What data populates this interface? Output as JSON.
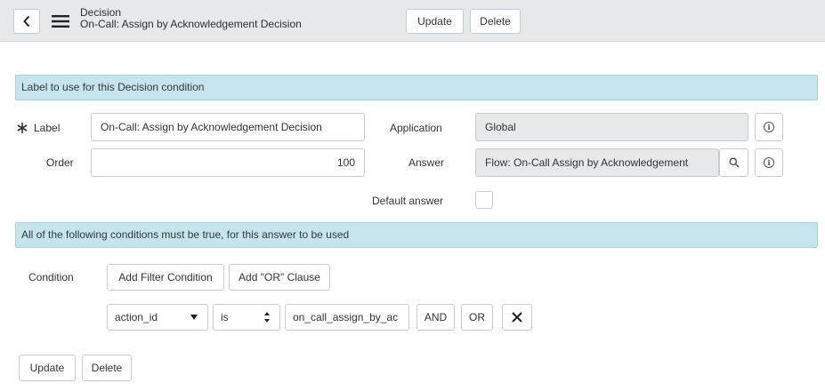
{
  "header": {
    "title_type": "Decision",
    "title_record": "On-Call: Assign by Acknowledgement Decision",
    "update_label": "Update",
    "delete_label": "Delete"
  },
  "sections": {
    "label_section": "Label to use for this Decision condition",
    "conditions_section": "All of the following conditions must be true, for this answer to be used"
  },
  "form": {
    "label_label": "Label",
    "label_value": "On-Call: Assign by Acknowledgement Decision",
    "order_label": "Order",
    "order_value": "100",
    "application_label": "Application",
    "application_value": "Global",
    "answer_label": "Answer",
    "answer_value": "Flow: On-Call Assign by Acknowledgement",
    "default_answer_label": "Default answer",
    "default_answer_checked": false
  },
  "condition": {
    "condition_label": "Condition",
    "add_filter_label": "Add Filter Condition",
    "add_or_label": "Add \"OR\" Clause",
    "field_value": "action_id",
    "operator_value": "is",
    "value_value": "on_call_assign_by_ac",
    "and_label": "AND",
    "or_label": "OR"
  },
  "footer": {
    "update_label": "Update",
    "delete_label": "Delete"
  },
  "icons": {
    "back": "chevron-left-icon",
    "menu": "hamburger-menu-icon",
    "info": "info-icon",
    "search": "search-icon",
    "remove": "close-icon",
    "required": "asterisk-icon"
  },
  "colors": {
    "header_bg": "#e6e8ea",
    "section_bg": "#c6e4ec",
    "readonly_bg": "#e6e8ea"
  }
}
